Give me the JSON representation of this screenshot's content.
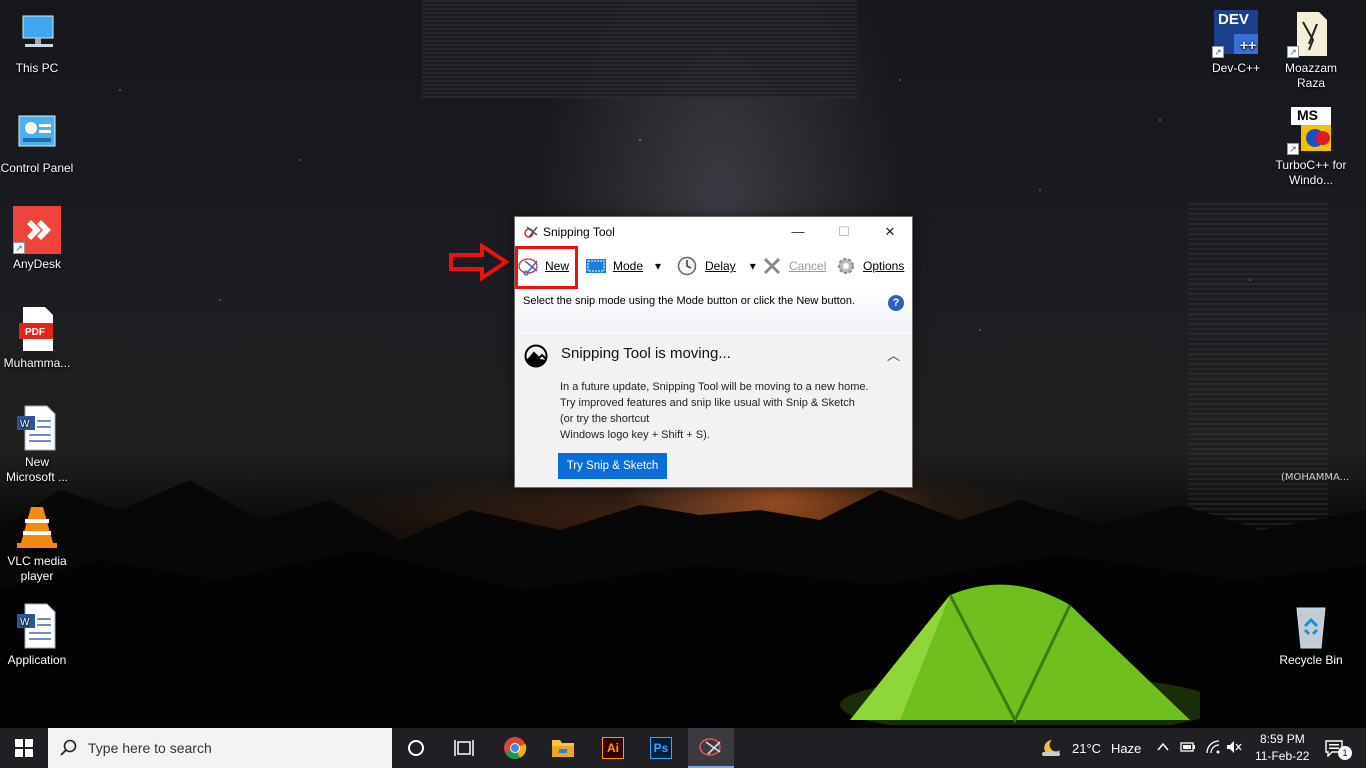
{
  "desktop_icons": [
    {
      "id": "this-pc",
      "label": "This PC"
    },
    {
      "id": "control-panel",
      "label": "Control Panel"
    },
    {
      "id": "anydesk",
      "label": "AnyDesk"
    },
    {
      "id": "pdf",
      "label": "Muhamma..."
    },
    {
      "id": "word-new",
      "label": "New Microsoft ..."
    },
    {
      "id": "vlc",
      "label": "VLC media player"
    },
    {
      "id": "word-app",
      "label": "Application"
    },
    {
      "id": "devcpp",
      "label": "Dev-C++"
    },
    {
      "id": "moazzam",
      "label": "Moazzam Raza"
    },
    {
      "id": "turboc",
      "label": "TurboC++ for Windo..."
    },
    {
      "id": "recycle",
      "label": "Recycle Bin"
    }
  ],
  "icon_text": {
    "pdf": "PDF",
    "dev": "DEV",
    "ms": "MS",
    "shortcut": "↗"
  },
  "snipping_tool": {
    "title": "Snipping Tool",
    "window_buttons": {
      "minimize": "—",
      "maximize": "☐",
      "close": "✕"
    },
    "toolbar": {
      "new": "New",
      "mode": "Mode",
      "delay": "Delay",
      "cancel": "Cancel",
      "options": "Options",
      "dropdown": "▾"
    },
    "info_text": "Select the snip mode using the Mode button or click the New button.",
    "help": "?",
    "moving_panel": {
      "heading": "Snipping Tool is moving...",
      "body_line1": "In a future update, Snipping Tool will be moving to a new home. Try improved features and snip like usual with Snip & Sketch (or try the shortcut",
      "body_line2": "Windows logo key + Shift + S).",
      "button": "Try Snip & Sketch",
      "collapse": "︿"
    }
  },
  "overlay_text": "(MOHAMMA...",
  "taskbar": {
    "search_placeholder": "Type here to search",
    "weather_temp": "21°C",
    "weather_desc": "Haze",
    "time": "8:59 PM",
    "date": "11-Feb-22",
    "notification_count": "1",
    "apps": [
      "chrome",
      "file-explorer",
      "illustrator",
      "photoshop",
      "snipping-tool"
    ],
    "ai_label": "Ai",
    "ps_label": "Ps"
  },
  "colors": {
    "accent_blue": "#0a6ed8",
    "highlight_red": "#e11111",
    "taskbar": "#202024"
  }
}
